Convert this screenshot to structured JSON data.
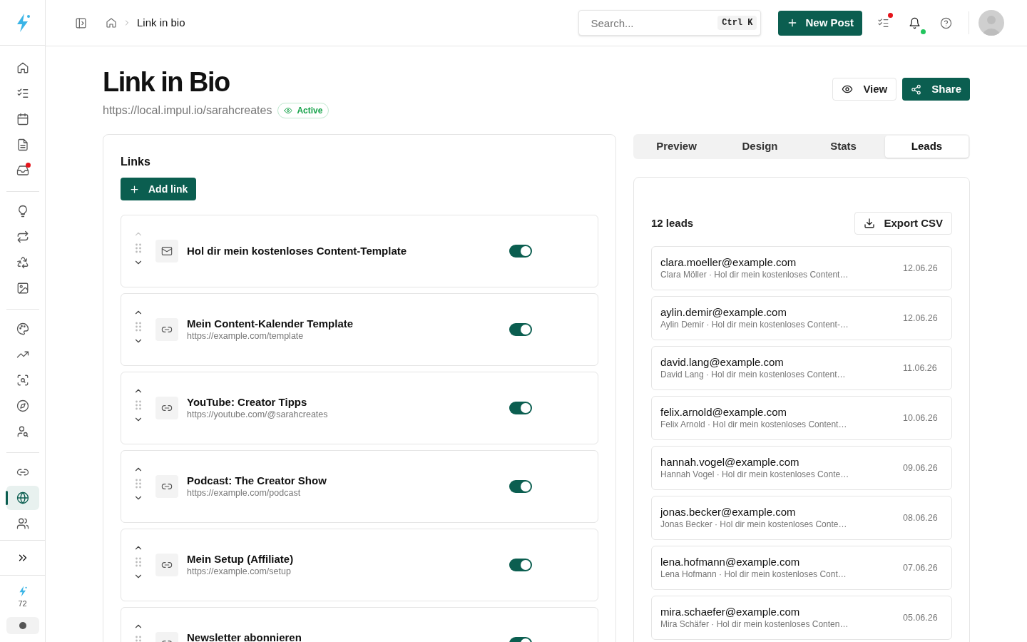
{
  "sidebar": {
    "groups": [
      [
        {
          "kind": "home",
          "selected": false,
          "badge": false
        },
        {
          "kind": "checklist",
          "selected": false,
          "badge": false
        },
        {
          "kind": "calendar",
          "selected": false,
          "badge": false
        },
        {
          "kind": "document",
          "selected": false,
          "badge": false
        },
        {
          "kind": "inbox",
          "selected": false,
          "badge": true
        }
      ],
      [
        {
          "kind": "bulb",
          "selected": false,
          "badge": false
        },
        {
          "kind": "repeat",
          "selected": false,
          "badge": false
        },
        {
          "kind": "recycle",
          "selected": false,
          "badge": false
        },
        {
          "kind": "image",
          "selected": false,
          "badge": false
        }
      ],
      [
        {
          "kind": "palette",
          "selected": false,
          "badge": false
        },
        {
          "kind": "trending",
          "selected": false,
          "badge": false
        },
        {
          "kind": "scan",
          "selected": false,
          "badge": false
        },
        {
          "kind": "compass",
          "selected": false,
          "badge": false
        },
        {
          "kind": "usersearch",
          "selected": false,
          "badge": false
        }
      ],
      [
        {
          "kind": "link",
          "selected": false,
          "badge": false
        },
        {
          "kind": "globe",
          "selected": true,
          "badge": false
        },
        {
          "kind": "users",
          "selected": false,
          "badge": false
        }
      ]
    ],
    "credits": "72"
  },
  "header": {
    "breadcrumb": "Link in bio",
    "search": {
      "placeholder": "Search...",
      "shortcut": "Ctrl K"
    },
    "new_post": "New Post",
    "icons": [
      {
        "kind": "tasks",
        "color": "#e5141b"
      },
      {
        "kind": "bell",
        "color": "#22c55e"
      },
      {
        "kind": "help"
      }
    ]
  },
  "page": {
    "title": "Link in Bio",
    "url": "https://local.impul.io/sarahcreates",
    "status": "Active",
    "view": "View",
    "share": "Share"
  },
  "links": {
    "heading": "Links",
    "add": "Add link",
    "items": [
      {
        "kind": "email",
        "title": "Hol dir mein kostenloses Content-Template",
        "enabled": true,
        "up_disabled": true
      },
      {
        "kind": "link",
        "title": "Mein Content-Kalender Template",
        "url": "https://example.com/template",
        "enabled": true,
        "up_disabled": false
      },
      {
        "kind": "link",
        "title": "YouTube: Creator Tipps",
        "url": "https://youtube.com/@sarahcreates",
        "enabled": true,
        "up_disabled": false
      },
      {
        "kind": "link",
        "title": "Podcast: The Creator Show",
        "url": "https://example.com/podcast",
        "enabled": true,
        "up_disabled": false
      },
      {
        "kind": "link",
        "title": "Mein Setup (Affiliate)",
        "url": "https://example.com/setup",
        "enabled": true,
        "up_disabled": false
      },
      {
        "kind": "link",
        "title": "Newsletter abonnieren",
        "enabled": true,
        "up_disabled": false
      }
    ]
  },
  "tabs": [
    {
      "label": "Preview",
      "selected": false
    },
    {
      "label": "Design",
      "selected": false
    },
    {
      "label": "Stats",
      "selected": false
    },
    {
      "label": "Leads",
      "selected": true
    }
  ],
  "leads": {
    "count": "12 leads",
    "export": "Export CSV",
    "items": [
      {
        "email": "clara.moeller@example.com",
        "detail": "Clara Möller · Hol dir mein kostenloses Content…",
        "date": "12.06.26"
      },
      {
        "email": "aylin.demir@example.com",
        "detail": "Aylin Demir · Hol dir mein kostenloses Content-…",
        "date": "12.06.26"
      },
      {
        "email": "david.lang@example.com",
        "detail": "David Lang · Hol dir mein kostenloses Content…",
        "date": "11.06.26"
      },
      {
        "email": "felix.arnold@example.com",
        "detail": "Felix Arnold · Hol dir mein kostenloses Content…",
        "date": "10.06.26"
      },
      {
        "email": "hannah.vogel@example.com",
        "detail": "Hannah Vogel · Hol dir mein kostenloses Conte…",
        "date": "09.06.26"
      },
      {
        "email": "jonas.becker@example.com",
        "detail": "Jonas Becker · Hol dir mein kostenloses Conte…",
        "date": "08.06.26"
      },
      {
        "email": "lena.hofmann@example.com",
        "detail": "Lena Hofmann · Hol dir mein kostenloses Cont…",
        "date": "07.06.26"
      },
      {
        "email": "mira.schaefer@example.com",
        "detail": "Mira Schäfer · Hol dir mein kostenloses Conten…",
        "date": "05.06.26"
      }
    ]
  }
}
